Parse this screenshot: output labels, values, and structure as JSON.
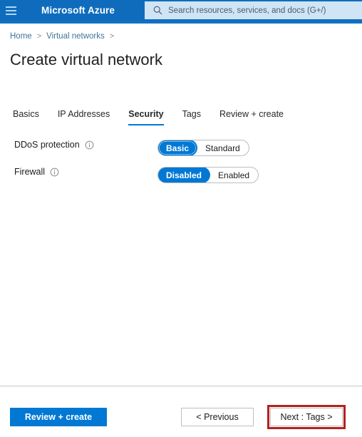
{
  "header": {
    "menu_icon": "hamburger-icon",
    "brand": "Microsoft Azure",
    "search": {
      "icon": "search-icon",
      "placeholder": "Search resources, services, and docs (G+/)",
      "value": ""
    }
  },
  "breadcrumb": {
    "items": [
      {
        "label": "Home"
      },
      {
        "label": "Virtual networks"
      }
    ],
    "separator": ">"
  },
  "page": {
    "title": "Create virtual network"
  },
  "tabs": [
    {
      "label": "Basics",
      "active": false
    },
    {
      "label": "IP Addresses",
      "active": false
    },
    {
      "label": "Security",
      "active": true
    },
    {
      "label": "Tags",
      "active": false
    },
    {
      "label": "Review + create",
      "active": false
    }
  ],
  "form": {
    "fields": [
      {
        "label": "DDoS protection",
        "info_icon": "info-icon",
        "options": [
          "Basic",
          "Standard"
        ],
        "selected": "Basic",
        "focused": true
      },
      {
        "label": "Firewall",
        "info_icon": "info-icon",
        "options": [
          "Disabled",
          "Enabled"
        ],
        "selected": "Disabled",
        "focused": false
      }
    ]
  },
  "footer": {
    "review_create_label": "Review + create",
    "previous_label": "< Previous",
    "next_label": "Next : Tags >"
  },
  "colors": {
    "header_blue": "#0f6cbd",
    "accent_blue": "#0078d4",
    "search_background": "#cfe4f5",
    "breadcrumb_link": "#3f7399",
    "highlight_red": "#b42121"
  }
}
